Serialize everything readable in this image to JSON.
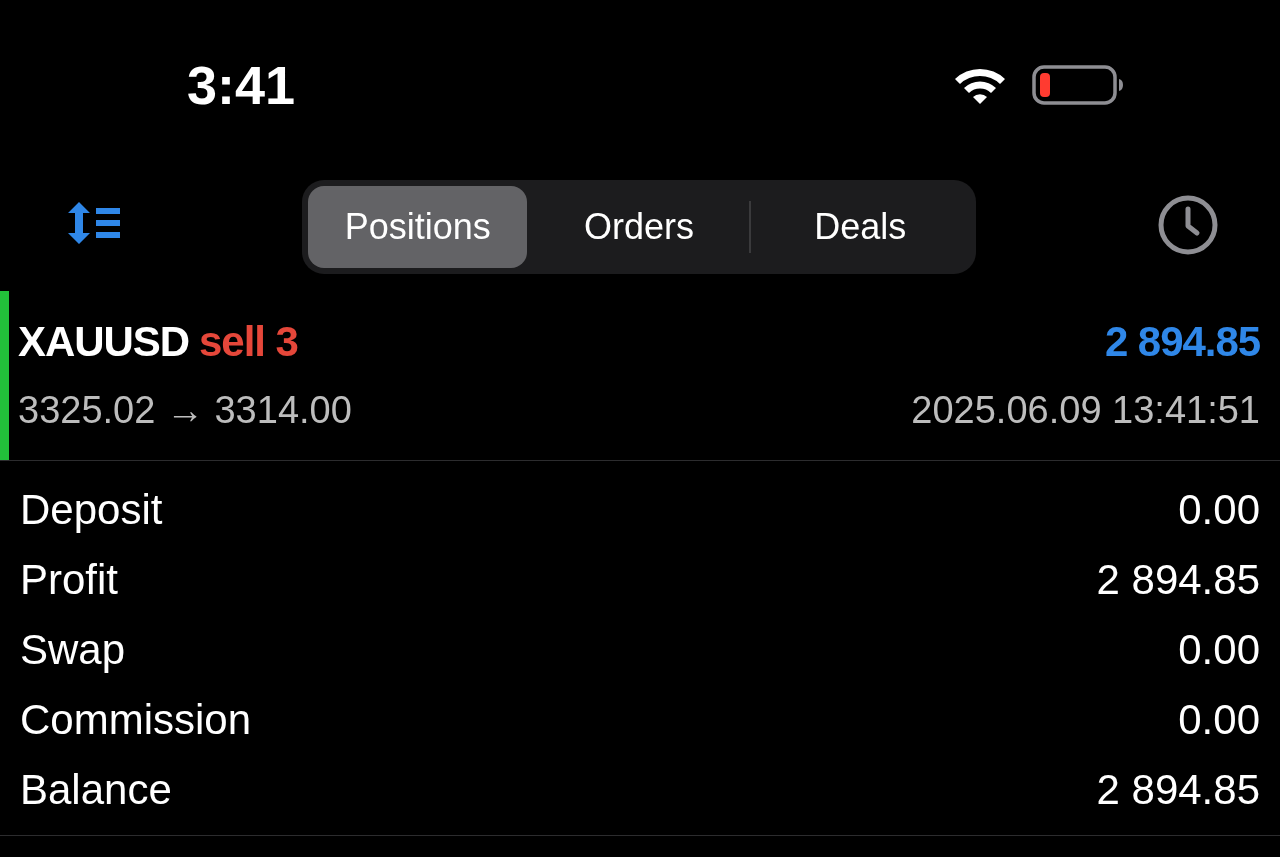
{
  "status_bar": {
    "time": "3:41"
  },
  "toolbar": {
    "tabs": [
      {
        "label": "Positions",
        "selected": true
      },
      {
        "label": "Orders",
        "selected": false
      },
      {
        "label": "Deals",
        "selected": false
      }
    ]
  },
  "position": {
    "symbol": "XAUUSD",
    "order": "sell 3",
    "profit": "2 894.85",
    "prices": "3325.02 → 3314.00",
    "time": "2025.06.09 13:41:51"
  },
  "summary": [
    {
      "label": "Deposit",
      "value": "0.00"
    },
    {
      "label": "Profit",
      "value": "2 894.85"
    },
    {
      "label": "Swap",
      "value": "0.00"
    },
    {
      "label": "Commission",
      "value": "0.00"
    },
    {
      "label": "Balance",
      "value": "2 894.85"
    }
  ]
}
